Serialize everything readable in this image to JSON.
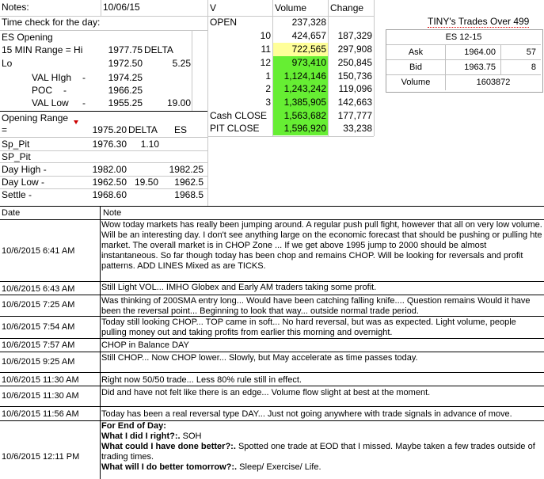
{
  "header": {
    "notes_label": "Notes:",
    "date_value": "10/06/15",
    "time_check_label": "Time check for the day:"
  },
  "opening_block": {
    "es_opening": "ES Opening",
    "range_label": "15 MIN Range = Hi",
    "range_hi": "1977.75",
    "delta_label": "DELTA",
    "lo_label": "Lo",
    "lo_value": "1972.50",
    "lo_delta": "5.25",
    "val_high_label": "VAL HIgh",
    "val_high_dash": "-",
    "val_high_value": "1974.25",
    "poc_label": "POC",
    "poc_dash": "-",
    "poc_value": "1966.25",
    "val_low_label": "VAL Low",
    "val_low_dash": "-",
    "val_low_value": "1955.25",
    "val_low_delta": "19.00"
  },
  "range_block": {
    "opening_range_label": "Opening Range",
    "eq_label": "=",
    "or_value": "1975.20",
    "delta_label": "DELTA",
    "es_label": "ES",
    "sp_pit_label": "Sp_Pit",
    "sp_pit_value": "1976.30",
    "sp_pit_delta": "1.10",
    "sp_pit2_label": "SP_Pit",
    "day_high_label": "Day High -",
    "day_high_value": "1982.00",
    "day_high_es": "1982.25",
    "day_low_label": "Day Low -",
    "day_low_value": "1962.50",
    "day_low_delta": "19.50",
    "day_low_es": "1962.5",
    "settle_label": "Settle -",
    "settle_value": "1968.60",
    "settle_es": "1968.5"
  },
  "volume_table": {
    "col_v": "V",
    "col_volume": "Volume",
    "col_change": "Change",
    "rows": [
      {
        "label": "OPEN",
        "volume": "237,328",
        "change": ""
      },
      {
        "label": "10",
        "volume": "424,657",
        "change": "187,329"
      },
      {
        "label": "11",
        "volume": "722,565",
        "change": "297,908"
      },
      {
        "label": "12",
        "volume": "973,410",
        "change": "250,845"
      },
      {
        "label": "1",
        "volume": "1,124,146",
        "change": "150,736"
      },
      {
        "label": "2",
        "volume": "1,243,242",
        "change": "119,096"
      },
      {
        "label": "3",
        "volume": "1,385,905",
        "change": "142,663"
      },
      {
        "label": "Cash CLOSE",
        "volume": "1,563,682",
        "change": "177,777"
      },
      {
        "label": "PIT CLOSE",
        "volume": "1,596,920",
        "change": "33,238"
      }
    ]
  },
  "tiny_trades": {
    "title": "TINY's Trades Over 499",
    "contract": "ES 12-15",
    "ask_label": "Ask",
    "ask_price": "1964.00",
    "ask_size": "57",
    "bid_label": "Bid",
    "bid_price": "1963.75",
    "bid_size": "8",
    "volume_label": "Volume",
    "volume_value": "1603872"
  },
  "log": {
    "col_date": "Date",
    "col_note": "Note",
    "entries": [
      {
        "date": "10/6/2015 6:41 AM",
        "note": "Wow today markets has really been jumping around.  A regular push pull fight, however that all on very low volume. Will be an interesting day.  I don't see anything large on the economic forecast that should be pushing or pulling hte market.  The overall market is in CHOP Zone ... If we get above 1995 jump to 2000 should be almost instantaneous. So far though today has been chop and remains CHOP.  Will be looking for reversals and profit patterns.  ADD LINES Mixed as are TICKS."
      },
      {
        "date": "10/6/2015 6:43 AM",
        "note": "Still Light VOL... IMHO Globex and Early AM traders taking some profit."
      },
      {
        "date": "10/6/2015 7:25 AM",
        "note": "Was thinking of 200SMA entry long... Would have been catching falling knife.... Question remains Would it have been the reversal point... Beginning to look that way... outside normal trade period."
      },
      {
        "date": "10/6/2015 7:54 AM",
        "note": "Today still looking CHOP... TOP came in soft... No hard reversal, but was as expected.  Light volume, people pulling money out and taking profits from earlier this morning and overnight."
      },
      {
        "date": "10/6/2015 7:57 AM",
        "note": "CHOP in Balance DAY"
      },
      {
        "date": "10/6/2015 9:25 AM",
        "note": "Still CHOP... Now CHOP lower... Slowly, but May accelerate as time passes today."
      },
      {
        "date": "10/6/2015 11:30 AM",
        "note": "Right now 50/50 trade... Less 80% rule still in effect."
      },
      {
        "date": "10/6/2015 11:30 AM",
        "note": "Did and have not felt like there is an edge... Volume flow slight at best at the moment."
      },
      {
        "date": "10/6/2015 11:56 AM",
        "note": "Today has been a real reversal type DAY... Just not going anywhere with trade signals in advance of move."
      }
    ],
    "final_entry": {
      "date": "10/6/2015 12:11 PM",
      "line1_bold": "For End of Day:",
      "line2_bold": "What I did I right?:.",
      "line2_text": " SOH",
      "line3_bold": "What could I have done better?:.",
      "line3_text": "  Spotted one trade at EOD that I missed.  Maybe taken a few trades outside of trading times.",
      "line4_bold": "What will I do better tomorrow?:.",
      "line4_text": "  Sleep/ Exercise/ Life."
    }
  },
  "colors": {
    "yellow_highlight": "#ffff99",
    "green_highlight": "#66ee33"
  }
}
